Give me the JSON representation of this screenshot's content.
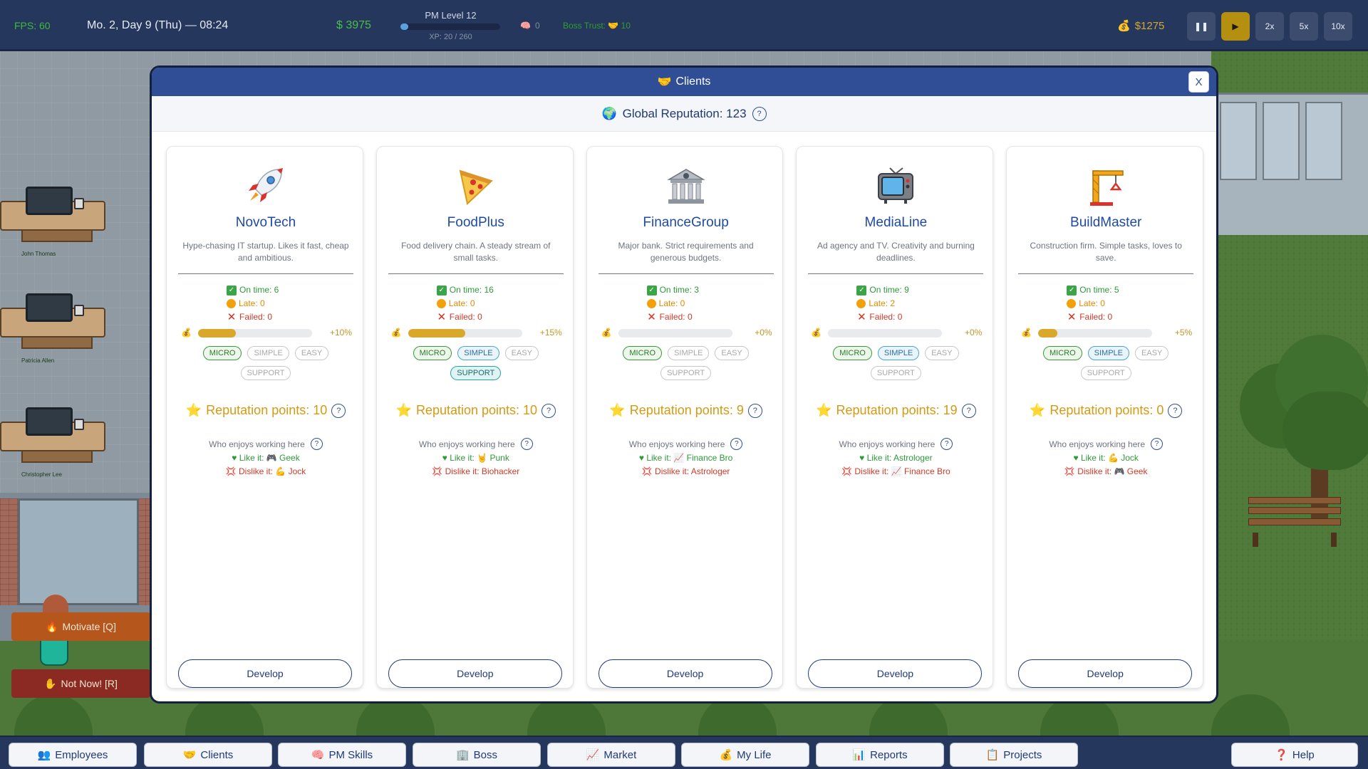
{
  "hud": {
    "fps": "FPS: 60",
    "date": "Mo. 2, Day 9 (Thu) — 08:24",
    "money": "$ 3975",
    "pm_level": "PM Level 12",
    "xp": "XP: 20 / 260",
    "xp_progress": 0.077,
    "brain_count": "0",
    "boss_trust": "Boss Trust: 🤝 10",
    "cash": "$1275",
    "speed_buttons": [
      "❚❚",
      "▶",
      "2x",
      "5x",
      "10x"
    ]
  },
  "scene": {
    "desk_names": [
      "John Thomas",
      "Patricia Allen",
      "Christopher Lee"
    ],
    "motivate_label": "Motivate [Q]",
    "not_now_label": "Not Now! [R]"
  },
  "modal": {
    "title": "Clients",
    "close": "X",
    "global_reputation": "Global Reputation: 123",
    "help": "?",
    "develop_label": "Develop",
    "enjoy_label": "Who enjoys working here"
  },
  "clients": [
    {
      "name": "NovoTech",
      "icon": "rocket-icon",
      "desc": "Hype-chasing IT startup. Likes it fast, cheap and ambitious.",
      "on_time": "On time: 6",
      "late": "Late: 0",
      "failed": "Failed: 0",
      "bonus_progress": 0.33,
      "bonus": "+10%",
      "tags": [
        "MICRO",
        "SIMPLE",
        "EASY",
        "SUPPORT"
      ],
      "tags_on": [
        true,
        false,
        false,
        false
      ],
      "rep_points": "Reputation points: 10",
      "like": "Like it: 🎮 Geek",
      "dislike": "Dislike it: 💪 Jock"
    },
    {
      "name": "FoodPlus",
      "icon": "pizza-icon",
      "desc": "Food delivery chain. A steady stream of small tasks.",
      "on_time": "On time: 16",
      "late": "Late: 0",
      "failed": "Failed: 0",
      "bonus_progress": 0.5,
      "bonus": "+15%",
      "tags": [
        "MICRO",
        "SIMPLE",
        "EASY",
        "SUPPORT"
      ],
      "tags_on": [
        true,
        true,
        false,
        true
      ],
      "rep_points": "Reputation points: 10",
      "like": "Like it: 🤘 Punk",
      "dislike": "Dislike it: Biohacker"
    },
    {
      "name": "FinanceGroup",
      "icon": "bank-icon",
      "desc": "Major bank. Strict requirements and generous budgets.",
      "on_time": "On time: 3",
      "late": "Late: 0",
      "failed": "Failed: 0",
      "bonus_progress": 0,
      "bonus": "+0%",
      "tags": [
        "MICRO",
        "SIMPLE",
        "EASY",
        "SUPPORT"
      ],
      "tags_on": [
        true,
        false,
        false,
        false
      ],
      "rep_points": "Reputation points: 9",
      "like": "Like it: 📈 Finance Bro",
      "dislike": "Dislike it: Astrologer"
    },
    {
      "name": "MediaLine",
      "icon": "tv-icon",
      "desc": "Ad agency and TV. Creativity and burning deadlines.",
      "on_time": "On time: 9",
      "late": "Late: 2",
      "failed": "Failed: 0",
      "bonus_progress": 0,
      "bonus": "+0%",
      "tags": [
        "MICRO",
        "SIMPLE",
        "EASY",
        "SUPPORT"
      ],
      "tags_on": [
        true,
        true,
        false,
        false
      ],
      "rep_points": "Reputation points: 19",
      "like": "Like it: Astrologer",
      "dislike": "Dislike it: 📈 Finance Bro"
    },
    {
      "name": "BuildMaster",
      "icon": "crane-icon",
      "desc": "Construction firm. Simple tasks, loves to save.",
      "on_time": "On time: 5",
      "late": "Late: 0",
      "failed": "Failed: 0",
      "bonus_progress": 0.17,
      "bonus": "+5%",
      "tags": [
        "MICRO",
        "SIMPLE",
        "EASY",
        "SUPPORT"
      ],
      "tags_on": [
        true,
        true,
        false,
        false
      ],
      "rep_points": "Reputation points: 0",
      "like": "Like it: 💪 Jock",
      "dislike": "Dislike it: 🎮 Geek"
    }
  ],
  "nav": [
    {
      "label": "Employees",
      "icon": "👥"
    },
    {
      "label": "Clients",
      "icon": "🤝"
    },
    {
      "label": "PM Skills",
      "icon": "🧠"
    },
    {
      "label": "Boss",
      "icon": "🏢"
    },
    {
      "label": "Market",
      "icon": "📈"
    },
    {
      "label": "My Life",
      "icon": "💰"
    },
    {
      "label": "Reports",
      "icon": "📊"
    },
    {
      "label": "Projects",
      "icon": "📋"
    }
  ],
  "help_nav": {
    "label": "Help",
    "icon": "❓"
  }
}
